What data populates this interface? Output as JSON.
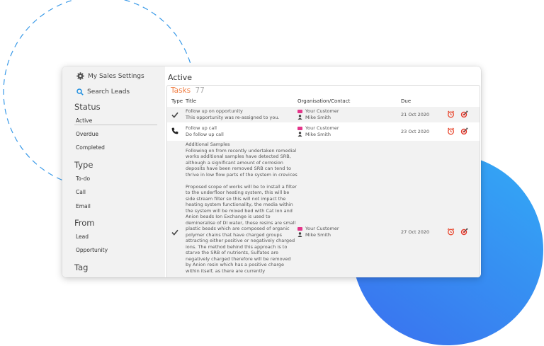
{
  "sidebar": {
    "settings_label": "My Sales Settings",
    "search_label": "Search Leads",
    "sections": [
      {
        "heading": "Status",
        "items": [
          "Active",
          "Overdue",
          "Completed"
        ]
      },
      {
        "heading": "Type",
        "items": [
          "To-do",
          "Call",
          "Email"
        ]
      },
      {
        "heading": "From",
        "items": [
          "Lead",
          "Opportunity"
        ]
      },
      {
        "heading": "Tag",
        "items": []
      }
    ],
    "selected": "Active"
  },
  "main": {
    "title": "Active",
    "tasks_label": "Tasks",
    "tasks_count": "77",
    "columns": [
      "Type",
      "Title",
      "Organisation/Contact",
      "Due"
    ],
    "rows": [
      {
        "type_icon": "check-icon",
        "title_lines": [
          "Follow up on opportunity",
          "This opportunity was re-assigned to you."
        ],
        "organisation": "Your Customer",
        "contact": "Mike Smith",
        "due": "21 Oct 2020"
      },
      {
        "type_icon": "phone-icon",
        "title_lines": [
          "Follow up call",
          "Do follow up call"
        ],
        "organisation": "Your Customer",
        "contact": "Mike Smith",
        "due": "23 Oct 2020"
      },
      {
        "type_icon": "check-icon",
        "title_lines": [
          "Additional Samples\nFollowing on from recently undertaken remedial works additional samples have detected SRB, although a significant amount of corrosion deposits have been removed SRB can tend to thrive in low flow parts of the system in crevices",
          "Proposed scope of works will be to install a filter to the underfloor heating system, this will be side stream filter so this will not impact the heating system functionality, the media within the system will be mixed bed with Cat Ion and Anion beads Ion Exchange is used to demineralise of DI water, these resins are small plastic beads which are composed of organic polymer chains that have charged groups attracting either positive or negatively charged ions. The method behind this approach is to starve the SRB of nutrients, Sulfates are negatively charged therefore will be removed by Anion resin which has a positive charge within itself, as there are currently"
        ],
        "organisation": "Your Customer",
        "contact": "Mike Smith",
        "due": "27 Oct 2020"
      }
    ]
  },
  "colors": {
    "accent_orange": "#f07b3f",
    "alarm_red": "#e8452c",
    "target_red": "#e33b2e",
    "org_pink": "#e4368a",
    "blue_circle": "#3d86f2",
    "search_blue": "#1f8fe0"
  }
}
